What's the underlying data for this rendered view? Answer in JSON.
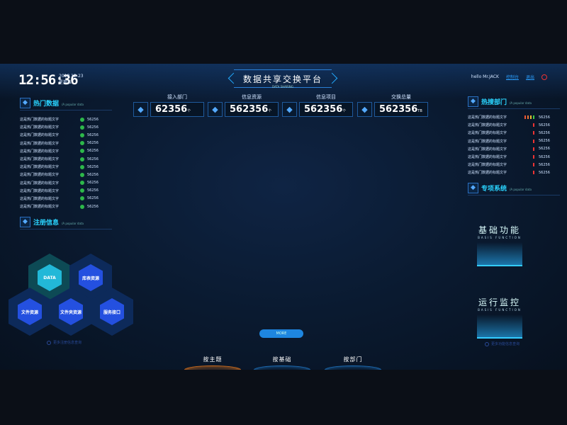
{
  "header": {
    "time": "12:56:36",
    "date": "2018 12-23",
    "weekday": "星期五",
    "title": "数据共享交换平台",
    "subtitle": "DATA SHARING",
    "greeting": "hello Mr.JACK",
    "console_link": "控制台",
    "logout_link": "退出"
  },
  "stats": [
    {
      "label": "接入部门",
      "value": "62356",
      "unit": "个"
    },
    {
      "label": "信息资源",
      "value": "562356",
      "unit": "个"
    },
    {
      "label": "信息项目",
      "value": "562356",
      "unit": "个"
    },
    {
      "label": "交换总量",
      "value": "562356",
      "unit": "TB"
    }
  ],
  "hot_data": {
    "title": "热门数据",
    "subtitle": "/A popular data",
    "items": [
      {
        "label": "这是热门数据的标题文字",
        "value": "56256"
      },
      {
        "label": "这是热门数据的标题文字",
        "value": "56256"
      },
      {
        "label": "这是热门数据的标题文字",
        "value": "56256"
      },
      {
        "label": "这是热门数据的标题文字",
        "value": "56256"
      },
      {
        "label": "这是热门数据的标题文字",
        "value": "56256"
      },
      {
        "label": "这是热门数据的标题文字",
        "value": "56256"
      },
      {
        "label": "这是热门数据的标题文字",
        "value": "56256"
      },
      {
        "label": "这是热门数据的标题文字",
        "value": "56256"
      },
      {
        "label": "这是热门数据的标题文字",
        "value": "56256"
      },
      {
        "label": "这是热门数据的标题文字",
        "value": "56256"
      },
      {
        "label": "这是热门数据的标题文字",
        "value": "56256"
      },
      {
        "label": "这是热门数据的标题文字",
        "value": "56256"
      }
    ]
  },
  "register": {
    "title": "注册信息",
    "subtitle": "/A popular data",
    "hexes": [
      "DATA",
      "库表资源",
      "文件资源",
      "文件夹资源",
      "服务接口"
    ],
    "more": "更多注册信息查询"
  },
  "hot_dept": {
    "title": "热搜部门",
    "subtitle": "/A popular data",
    "items": [
      {
        "label": "这是热门数据的标题文字",
        "value": "56256",
        "trend": [
          "#e53",
          "#e73",
          "#eb3",
          "#4c4"
        ]
      },
      {
        "label": "这是热门数据的标题文字",
        "value": "56256",
        "trend": [
          "#e33"
        ]
      },
      {
        "label": "这是热门数据的标题文字",
        "value": "56256",
        "trend": [
          "#e33"
        ]
      },
      {
        "label": "这是热门数据的标题文字",
        "value": "56256",
        "trend": [
          "#e33"
        ]
      },
      {
        "label": "这是热门数据的标题文字",
        "value": "56256",
        "trend": [
          "#e33"
        ]
      },
      {
        "label": "这是热门数据的标题文字",
        "value": "56256",
        "trend": [
          "#e33"
        ]
      },
      {
        "label": "这是热门数据的标题文字",
        "value": "56256",
        "trend": [
          "#e33"
        ]
      },
      {
        "label": "这是热门数据的标题文字",
        "value": "56256",
        "trend": [
          "#e33"
        ]
      }
    ]
  },
  "special": {
    "title": "专项系统",
    "subtitle": "/A popular data",
    "functions": [
      {
        "title": "基础功能",
        "subtitle": "BASIS FUNCTION"
      },
      {
        "title": "运行监控",
        "subtitle": "BASIS FUNCTION"
      }
    ],
    "more": "更多功能信息查询"
  },
  "center": {
    "more_button": "MORE",
    "tabs": [
      {
        "label": "按主题",
        "active": true
      },
      {
        "label": "按基础",
        "active": false
      },
      {
        "label": "按部门",
        "active": false
      }
    ]
  }
}
